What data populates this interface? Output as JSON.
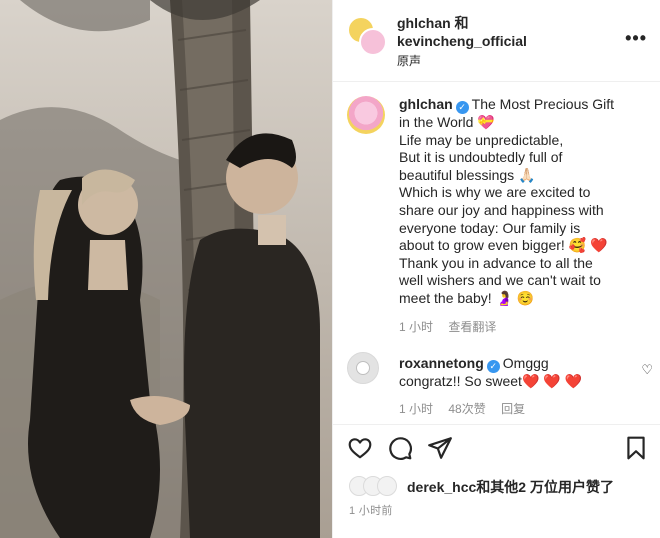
{
  "post": {
    "header": {
      "author_line1": "ghlchan 和",
      "author_line2": "kevincheng_official",
      "subtitle": "原声",
      "more_glyph": "•••"
    },
    "caption": {
      "username": "ghlchan",
      "lines": [
        "The Most Precious Gift",
        "in the World 💝",
        "Life may be unpredictable,",
        "But it is undoubtedly full of",
        "beautiful blessings 🙏🏻",
        "Which is why we are excited to",
        "share our joy and happiness with",
        "everyone today: Our family is",
        "about to grow even bigger! 🥰 ❤️",
        "Thank you in advance to all the",
        "well wishers and we can't wait to",
        "meet the baby! 🤰 ☺️"
      ],
      "time": "1 小时",
      "translate": "查看翻译"
    },
    "comment": {
      "username": "roxannetong",
      "text_line1": "Omggg",
      "text_line2": "congratz!! So sweet❤️ ❤️ ❤️",
      "time": "1 小时",
      "likes": "48次赞",
      "reply": "回复"
    },
    "likes_summary": "derek_hcc和其他2 万位用户赞了",
    "posted_time": "1 小时前",
    "icons": {
      "like": "heart-outline-icon",
      "comment": "comment-bubble-icon",
      "share": "paper-plane-icon",
      "save": "bookmark-icon",
      "verified": "verified-badge-icon"
    },
    "colors": {
      "verified": "#3897f0",
      "meta_text": "#8e8e8e",
      "heart": "#ed4956"
    }
  }
}
